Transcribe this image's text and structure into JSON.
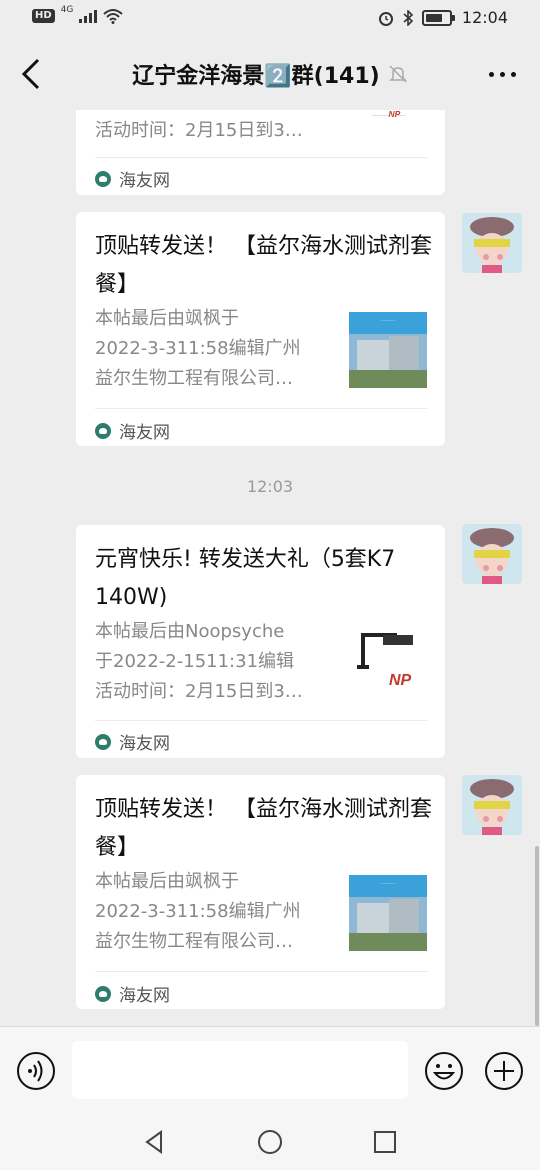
{
  "status_bar": {
    "left_badge": "HD",
    "network": "4G",
    "time": "12:04",
    "icons": [
      "alarm-icon",
      "bluetooth-icon",
      "battery-icon"
    ]
  },
  "header": {
    "title": "辽宁金洋海景2️⃣群(141)",
    "back_icon": "chevron-left-icon",
    "mute_icon": "bell-muted-icon",
    "more_icon": "more-dots-icon"
  },
  "messages": [
    {
      "desc": "活动时间：2月15日到3…",
      "thumb": "light-product-image",
      "source": "海友网"
    },
    {
      "title": "顶贴转发送！ 【益尔海水测试剂套餐】",
      "desc": "本帖最后由飒枫于\n2022-3-311:58编辑广州\n益尔生物工程有限公司…",
      "thumb": "building-image",
      "source": "海友网"
    },
    {
      "time": "12:03"
    },
    {
      "title": "元宵快乐! 转发送大礼（5套K7  140W)",
      "desc": "本帖最后由Noopsyche\n于2022-2-1511:31编辑\n活动时间：2月15日到3…",
      "thumb": "light-product-image",
      "source": "海友网"
    },
    {
      "title": "顶贴转发送！ 【益尔海水测试剂套餐】",
      "desc": "本帖最后由飒枫于\n2022-3-311:58编辑广州\n益尔生物工程有限公司…",
      "thumb": "building-image",
      "source": "海友网"
    }
  ],
  "input_bar": {
    "voice_icon": "voice-icon",
    "emoji_icon": "emoji-icon",
    "plus_icon": "plus-circle-icon",
    "value": ""
  },
  "nav_bar": {
    "icons": [
      "back-triangle-icon",
      "home-circle-icon",
      "recents-square-icon"
    ]
  }
}
